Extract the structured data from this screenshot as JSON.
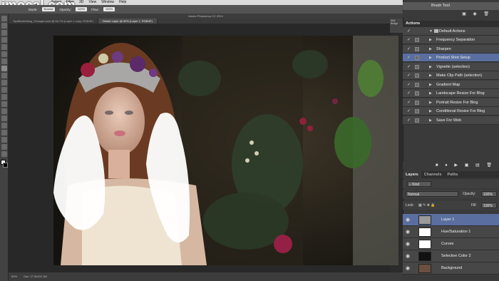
{
  "watermark": "imocal.com",
  "menubar": {
    "items": [
      "Select",
      "Filter",
      "3D",
      "View",
      "Window",
      "Help"
    ]
  },
  "options_bar": {
    "mode_label": "Mode:",
    "mode_value": "Normal",
    "opacity_label": "Opacity:",
    "opacity_value": "100%",
    "flow_label": "Flow:",
    "flow_value": "100%"
  },
  "title": "Adobe Photoshop CC 2014",
  "doc_tabs": [
    {
      "label": "TopBlindfolding_Changed.psd @ 66.7% (Layer 1 copy, RGB/8*)"
    },
    {
      "label": "Delete Layer @ 50% (Layer 1, RGB/8*)"
    }
  ],
  "status": {
    "zoom": "50%",
    "doc": "Doc: 17.5M/22.3M"
  },
  "mini_panel": "Mini Bridge",
  "history": {
    "item": "Brush Tool",
    "icons": "▣ ◉ 🗑"
  },
  "actions": {
    "title": "Actions",
    "set_name": "Default Actions",
    "items": [
      {
        "label": "Frequency Separation",
        "selected": false
      },
      {
        "label": "Sharpen",
        "selected": false
      },
      {
        "label": "Product Shot Setup",
        "selected": true
      },
      {
        "label": "Vignette (selection)",
        "selected": false
      },
      {
        "label": "Make Clip Path (selection)",
        "selected": false
      },
      {
        "label": "Gradient Map",
        "selected": false
      },
      {
        "label": "Landscape Resize For Blog",
        "selected": false
      },
      {
        "label": "Portrait Resize For Blog",
        "selected": false
      },
      {
        "label": "Conditional Resize For Blog",
        "selected": false
      },
      {
        "label": "Save For Web",
        "selected": false
      }
    ],
    "footer_icons": "■ ● ▶ ▣ ▤ 🗑"
  },
  "layers_panel": {
    "tabs": [
      "Layers",
      "Channels",
      "Paths"
    ],
    "kind_label": "Kind",
    "blend_mode": "Normal",
    "opacity_label": "Opacity:",
    "opacity_value": "100%",
    "lock_label": "Lock:",
    "fill_label": "Fill:",
    "fill_value": "100%",
    "layers": [
      {
        "name": "Layer 1",
        "selected": true,
        "thumb": "#9a9a9a"
      },
      {
        "name": "Hue/Saturation 1",
        "selected": false,
        "thumb": "#ffffff"
      },
      {
        "name": "Curves",
        "selected": false,
        "thumb": "#ffffff"
      },
      {
        "name": "Selective Color 2",
        "selected": false,
        "thumb": "#111111"
      },
      {
        "name": "Background",
        "selected": false,
        "thumb": "#6b5040"
      }
    ]
  }
}
